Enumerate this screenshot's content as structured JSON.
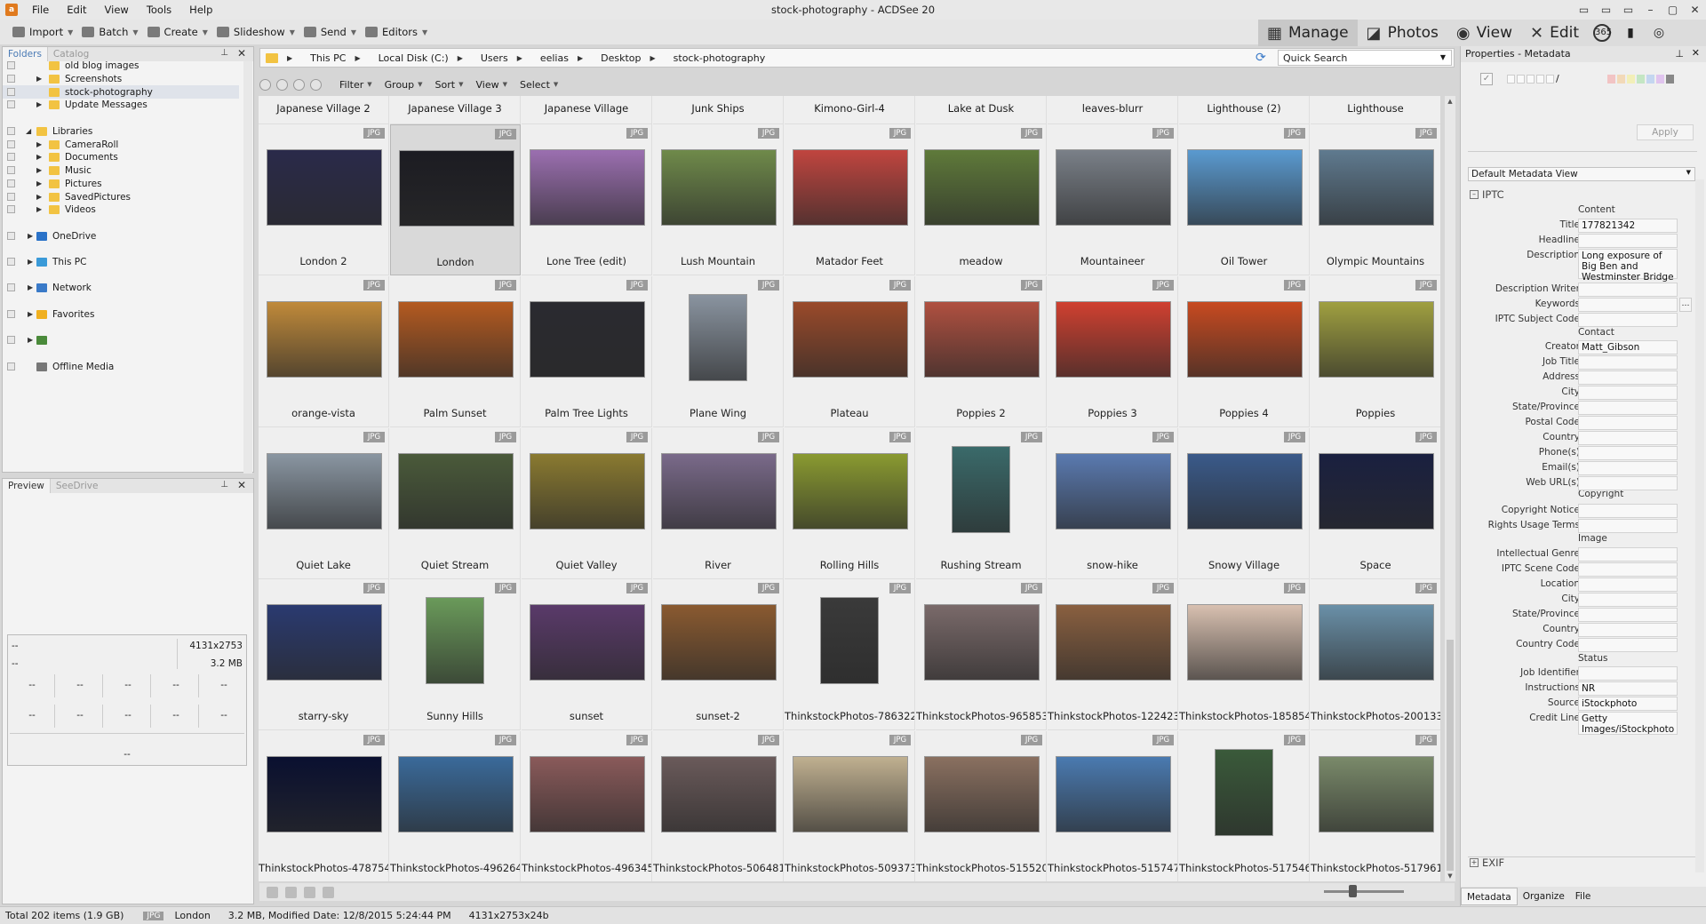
{
  "window": {
    "title": "stock-photography - ACDSee 20"
  },
  "menu": [
    "File",
    "Edit",
    "View",
    "Tools",
    "Help"
  ],
  "toolbar": [
    {
      "label": "Import"
    },
    {
      "label": "Batch"
    },
    {
      "label": "Create"
    },
    {
      "label": "Slideshow"
    },
    {
      "label": "Send"
    },
    {
      "label": "Editors"
    }
  ],
  "modes": {
    "manage": "Manage",
    "photos": "Photos",
    "view": "View",
    "edit": "Edit",
    "three65": "365"
  },
  "left_panel": {
    "tabs": {
      "folders": "Folders",
      "catalog": "Catalog"
    },
    "tree": [
      {
        "label": "old blog images",
        "indent": 2,
        "arrow": false,
        "icon": "folder"
      },
      {
        "label": "Screenshots",
        "indent": 2,
        "arrow": true,
        "icon": "folder"
      },
      {
        "label": "stock-photography",
        "indent": 2,
        "arrow": false,
        "icon": "folder",
        "selected": true
      },
      {
        "label": "Update Messages",
        "indent": 2,
        "arrow": true,
        "icon": "folder"
      },
      {
        "label": "Libraries",
        "indent": 0,
        "arrow": true,
        "icon": "library",
        "expanded": true
      },
      {
        "label": "CameraRoll",
        "indent": 1,
        "arrow": true,
        "icon": "folder-lib"
      },
      {
        "label": "Documents",
        "indent": 1,
        "arrow": true,
        "icon": "folder-lib"
      },
      {
        "label": "Music",
        "indent": 1,
        "arrow": true,
        "icon": "folder-lib"
      },
      {
        "label": "Pictures",
        "indent": 1,
        "arrow": true,
        "icon": "folder-lib"
      },
      {
        "label": "SavedPictures",
        "indent": 1,
        "arrow": true,
        "icon": "folder-lib"
      },
      {
        "label": "Videos",
        "indent": 1,
        "arrow": true,
        "icon": "folder-lib"
      },
      {
        "label": "OneDrive",
        "indent": -1,
        "arrow": true,
        "icon": "cloud"
      },
      {
        "label": "This PC",
        "indent": -1,
        "arrow": true,
        "icon": "pc"
      },
      {
        "label": "Network",
        "indent": -1,
        "arrow": true,
        "icon": "network"
      },
      {
        "label": "Favorites",
        "indent": -1,
        "arrow": true,
        "icon": "star"
      },
      {
        "label": "",
        "indent": -1,
        "arrow": true,
        "icon": "person"
      },
      {
        "label": "Offline Media",
        "indent": -1,
        "arrow": false,
        "icon": "disc"
      }
    ],
    "preview_tabs": {
      "preview": "Preview",
      "seedrive": "SeeDrive"
    },
    "preview": {
      "dims": "4131x2753",
      "size": "3.2 MB",
      "dash": "--"
    }
  },
  "path": {
    "segments": [
      "This PC",
      "Local Disk (C:)",
      "Users",
      "eelias",
      "Desktop",
      "stock-photography"
    ],
    "search": "Quick Search"
  },
  "filterbar": [
    "Filter",
    "Group",
    "Sort",
    "View",
    "Select"
  ],
  "top_labels": [
    "Japanese Village 2",
    "Japanese Village 3",
    "Japanese Village",
    "Junk Ships",
    "Kimono-Girl-4",
    "Lake at Dusk",
    "leaves-blurr",
    "Lighthouse (2)",
    "Lighthouse"
  ],
  "files": [
    [
      "London 2",
      "London",
      "Lone Tree (edit)",
      "Lush Mountain",
      "Matador Feet",
      "meadow",
      "Mountaineer",
      "Oil Tower",
      "Olympic Mountains"
    ],
    [
      "orange-vista",
      "Palm Sunset",
      "Palm Tree Lights",
      "Plane Wing",
      "Plateau",
      "Poppies 2",
      "Poppies 3",
      "Poppies 4",
      "Poppies"
    ],
    [
      "Quiet Lake",
      "Quiet Stream",
      "Quiet Valley",
      "River",
      "Rolling Hills",
      "Rushing Stream",
      "snow-hike",
      "Snowy Village",
      "Space"
    ],
    [
      "starry-sky",
      "Sunny Hills",
      "sunset",
      "sunset-2",
      "ThinkstockPhotos-786322...",
      "ThinkstockPhotos-965853...",
      "ThinkstockPhotos-122423...",
      "ThinkstockPhotos-185854...",
      "ThinkstockPhotos-200133..."
    ],
    [
      "ThinkstockPhotos-478754...",
      "ThinkstockPhotos-496264...",
      "ThinkstockPhotos-496345...",
      "ThinkstockPhotos-506481...",
      "ThinkstockPhotos-509373...",
      "ThinkstockPhotos-515520...",
      "ThinkstockPhotos-515747...",
      "ThinkstockPhotos-517546...",
      "ThinkstockPhotos-517961..."
    ]
  ],
  "badge": "JPG",
  "thumb_colors": [
    [
      "#2a2a4a",
      "#1c1c22",
      "#9b6fb0",
      "#6f8a4a",
      "#c0453f",
      "#5f7a3a",
      "#7a8088",
      "#5a9ad0",
      "#5f7a8f"
    ],
    [
      "#c08a3a",
      "#b45a20",
      "#2a2a30",
      "#8a94a0",
      "#9a4a2a",
      "#b05040",
      "#d04030",
      "#c84a20",
      "#a0a040"
    ],
    [
      "#8a96a2",
      "#4a5a3a",
      "#8a7a30",
      "#7a6a8a",
      "#8a9a30",
      "#3a6a6a",
      "#5a7ab0",
      "#3a5a8a",
      "#1a2040"
    ],
    [
      "#2a3a70",
      "#6a9a5a",
      "#5a3a6a",
      "#8a5a30",
      "#3a3a3a",
      "#7a6a6a",
      "#8a6040",
      "#d8c0b0",
      "#6a90a8"
    ],
    [
      "#0a1030",
      "#3a6a9a",
      "#8a5a5a",
      "#6a5a5a",
      "#c0b090",
      "#8a7060",
      "#4a7ab0",
      "#3a5a3a",
      "#7a8a6a"
    ]
  ],
  "thumb_shape": [
    [
      "l",
      "l",
      "l",
      "l",
      "l",
      "l",
      "l",
      "l",
      "l"
    ],
    [
      "l",
      "l",
      "l",
      "p",
      "l",
      "l",
      "l",
      "l",
      "l"
    ],
    [
      "l",
      "l",
      "l",
      "l",
      "l",
      "p",
      "l",
      "l",
      "l"
    ],
    [
      "l",
      "p",
      "l",
      "l",
      "p",
      "l",
      "l",
      "l",
      "l"
    ],
    [
      "l",
      "l",
      "l",
      "l",
      "l",
      "l",
      "l",
      "p",
      "l"
    ]
  ],
  "selected_cell": [
    0,
    1
  ],
  "status": {
    "total": "Total 202 items  (1.9 GB)",
    "type": "JPG",
    "name": "London",
    "info": "3.2 MB, Modified Date: 12/8/2015 5:24:44 PM",
    "dims": "4131x2753x24b"
  },
  "right_panel": {
    "title": "Properties - Metadata",
    "apply": "Apply",
    "view": "Default Metadata View",
    "section": "IPTC",
    "exif": "EXIF",
    "groups": {
      "content": "Content",
      "contact": "Contact",
      "copyright": "Copyright",
      "image": "Image",
      "status": "Status"
    },
    "fields": [
      {
        "label": "Title",
        "value": "177821342"
      },
      {
        "label": "Headline",
        "value": ""
      },
      {
        "label": "Description",
        "value": "Long exposure of Big Ben and Westminster Bridge in London"
      },
      {
        "label": "Description Writer",
        "value": ""
      },
      {
        "label": "Keywords",
        "value": ""
      },
      {
        "label": "IPTC Subject Code",
        "value": ""
      },
      {
        "label": "Creator",
        "value": "Matt_Gibson"
      },
      {
        "label": "Job Title",
        "value": ""
      },
      {
        "label": "Address",
        "value": ""
      },
      {
        "label": "City",
        "value": ""
      },
      {
        "label": "State/Province",
        "value": ""
      },
      {
        "label": "Postal Code",
        "value": ""
      },
      {
        "label": "Country",
        "value": ""
      },
      {
        "label": "Phone(s)",
        "value": ""
      },
      {
        "label": "Email(s)",
        "value": ""
      },
      {
        "label": "Web URL(s)",
        "value": ""
      },
      {
        "label": "Copyright Notice",
        "value": ""
      },
      {
        "label": "Rights Usage Terms",
        "value": ""
      },
      {
        "label": "Intellectual Genre",
        "value": ""
      },
      {
        "label": "IPTC Scene Code",
        "value": ""
      },
      {
        "label": "Location",
        "value": ""
      },
      {
        "label": "City",
        "value": ""
      },
      {
        "label": "State/Province",
        "value": ""
      },
      {
        "label": "Country",
        "value": ""
      },
      {
        "label": "Country Code",
        "value": ""
      },
      {
        "label": "Job Identifier",
        "value": ""
      },
      {
        "label": "Instructions",
        "value": "NR"
      },
      {
        "label": "Source",
        "value": "iStockphoto"
      },
      {
        "label": "Credit Line",
        "value": "Getty Images/iStockphoto"
      }
    ],
    "bottom_tabs": [
      "Metadata",
      "Organize",
      "File"
    ]
  }
}
